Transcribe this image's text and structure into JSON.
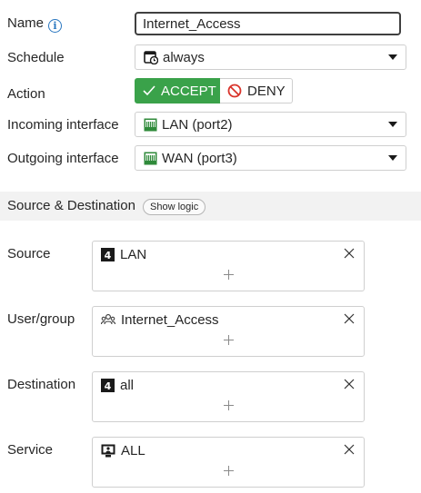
{
  "form": {
    "name": {
      "label": "Name",
      "value": "Internet_Access"
    },
    "schedule": {
      "label": "Schedule",
      "value": "always"
    },
    "action": {
      "label": "Action",
      "accept_label": "ACCEPT",
      "deny_label": "DENY",
      "selected": "ACCEPT"
    },
    "incoming": {
      "label": "Incoming interface",
      "value": "LAN (port2)"
    },
    "outgoing": {
      "label": "Outgoing interface",
      "value": "WAN (port3)"
    }
  },
  "section": {
    "title": "Source & Destination",
    "show_logic_label": "Show logic"
  },
  "fields": {
    "source": {
      "label": "Source",
      "entry": "LAN"
    },
    "user_group": {
      "label": "User/group",
      "entry": "Internet_Access"
    },
    "destination": {
      "label": "Destination",
      "entry": "all"
    },
    "service": {
      "label": "Service",
      "entry": "ALL"
    }
  },
  "colors": {
    "accept_green": "#3aa24a",
    "deny_red": "#d9342b",
    "info_blue": "#2a77c0",
    "section_bg": "#f2f2f2"
  }
}
